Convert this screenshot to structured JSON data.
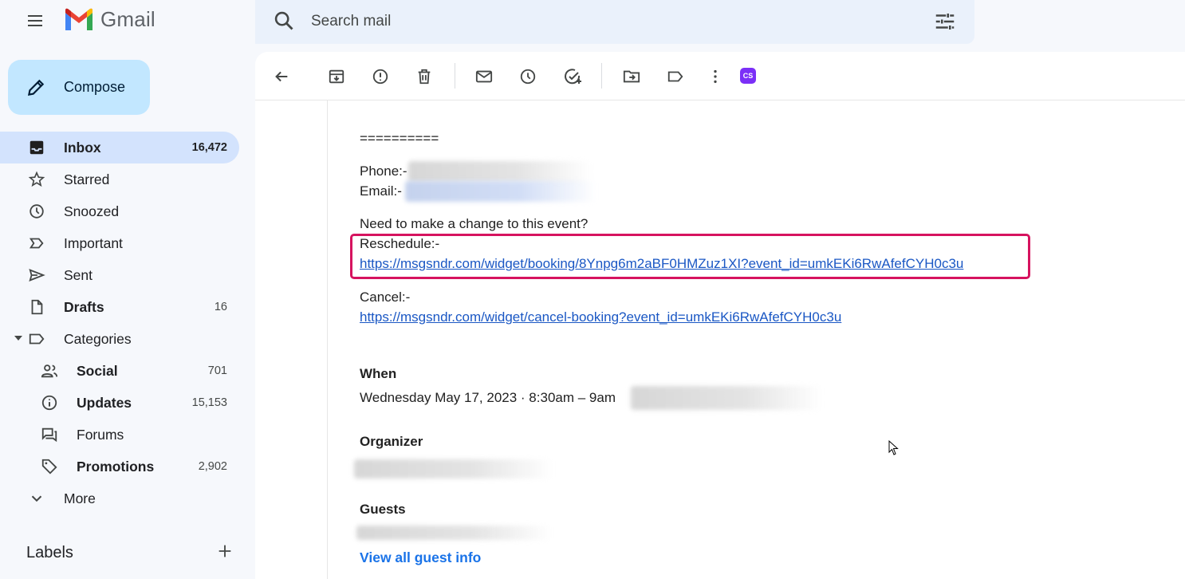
{
  "app": {
    "name": "Gmail",
    "logo_letter": "M",
    "brand_colors": [
      "#ea4335",
      "#4285f4",
      "#34a853",
      "#fbbc04",
      "#c5221f"
    ]
  },
  "search": {
    "placeholder": "Search mail",
    "value": ""
  },
  "compose": {
    "label": "Compose"
  },
  "nav": {
    "items": [
      {
        "label": "Inbox",
        "count": "16,472",
        "icon": "inbox-icon"
      },
      {
        "label": "Starred",
        "count": "",
        "icon": "star-icon"
      },
      {
        "label": "Snoozed",
        "count": "",
        "icon": "clock-icon"
      },
      {
        "label": "Important",
        "count": "",
        "icon": "important-icon"
      },
      {
        "label": "Sent",
        "count": "",
        "icon": "send-icon"
      },
      {
        "label": "Drafts",
        "count": "16",
        "icon": "draft-icon"
      },
      {
        "label": "Categories",
        "count": "",
        "icon": "label-icon"
      },
      {
        "label": "Social",
        "count": "701",
        "icon": "people-icon"
      },
      {
        "label": "Updates",
        "count": "15,153",
        "icon": "info-icon"
      },
      {
        "label": "Forums",
        "count": "",
        "icon": "forum-icon"
      },
      {
        "label": "Promotions",
        "count": "2,902",
        "icon": "tag-icon"
      },
      {
        "label": "More",
        "count": "",
        "icon": "chevron-down-icon"
      }
    ],
    "labels_title": "Labels"
  },
  "toolbar": {
    "icons": [
      "back-icon",
      "archive-icon",
      "report-spam-icon",
      "delete-icon",
      "mark-unread-icon",
      "snooze-icon",
      "add-task-icon",
      "move-to-icon",
      "label-icon",
      "more-icon"
    ],
    "extension_badge": "CS"
  },
  "email": {
    "separator": "==========",
    "phone_label": "Phone:-",
    "email_label": "Email:-",
    "change_prompt": "Need to make a change to this event?",
    "reschedule_label": "Reschedule:-",
    "reschedule_link": "https://msgsndr.com/widget/booking/8Ynpg6m2aBF0HMZuz1XI?event_id=umkEKi6RwAfefCYH0c3u",
    "cancel_label": "Cancel:-",
    "cancel_link": "https://msgsndr.com/widget/cancel-booking?event_id=umkEKi6RwAfefCYH0c3u",
    "when_heading": "When",
    "when_value": "Wednesday May 17, 2023 · 8:30am – 9am",
    "organizer_heading": "Organizer",
    "guests_heading": "Guests",
    "view_all_guests": "View all guest info"
  },
  "colors": {
    "accent": "#1a73e8",
    "highlight_box": "#d6135f",
    "active_nav": "#d3e3fd",
    "compose_bg": "#c2e7ff"
  }
}
